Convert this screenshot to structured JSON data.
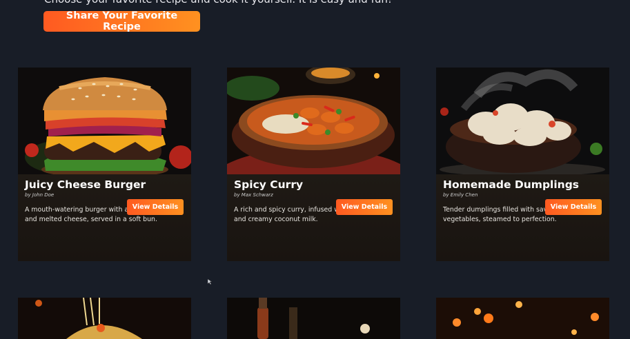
{
  "header": {
    "tagline": "Choose your favorite recipe and cook it yourself. It is easy and fun!",
    "share_button": "Share Your Favorite Recipe"
  },
  "recipes": [
    {
      "title": "Juicy Cheese Burger",
      "author": "by John Doe",
      "description": "A mouth-watering burger with a juicy beef patty and melted cheese, served in a soft bun.",
      "button": "View Details"
    },
    {
      "title": "Spicy Curry",
      "author": "by Max Schwarz",
      "description": "A rich and spicy curry, infused with exotic spices and creamy coconut milk.",
      "button": "View Details"
    },
    {
      "title": "Homemade Dumplings",
      "author": "by Emily Chen",
      "description": "Tender dumplings filled with savory meat and vegetables, steamed to perfection.",
      "button": "View Details"
    }
  ],
  "colors": {
    "background": "#181d27",
    "card_body": "#1b1511",
    "accent_start": "#ff5a21",
    "accent_end": "#ff9120"
  }
}
